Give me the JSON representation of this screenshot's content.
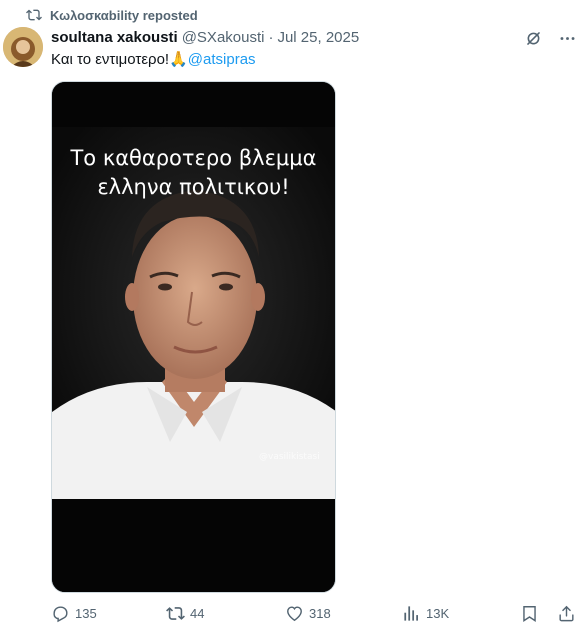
{
  "repost": {
    "label": "Κωλοσκαbility reposted"
  },
  "tweet": {
    "author_name": "soultana xakousti",
    "handle": "@SXakousti",
    "separator": "·",
    "date": "Jul 25, 2025",
    "text_before": "Και το εντιμοτερο!",
    "emoji": "🙏",
    "mention": "@atsipras",
    "media": {
      "caption_line1": "Το καθαροτερο βλεμμα",
      "caption_line2": "ελληνα πολιτικου!",
      "watermark": "@vasilikistasi"
    }
  },
  "actions": {
    "replies": "135",
    "reposts": "44",
    "likes": "318",
    "views": "13K"
  },
  "colors": {
    "accent": "#1d9bf0",
    "secondary_text": "#536471",
    "repost_green": "#00ba7c"
  }
}
